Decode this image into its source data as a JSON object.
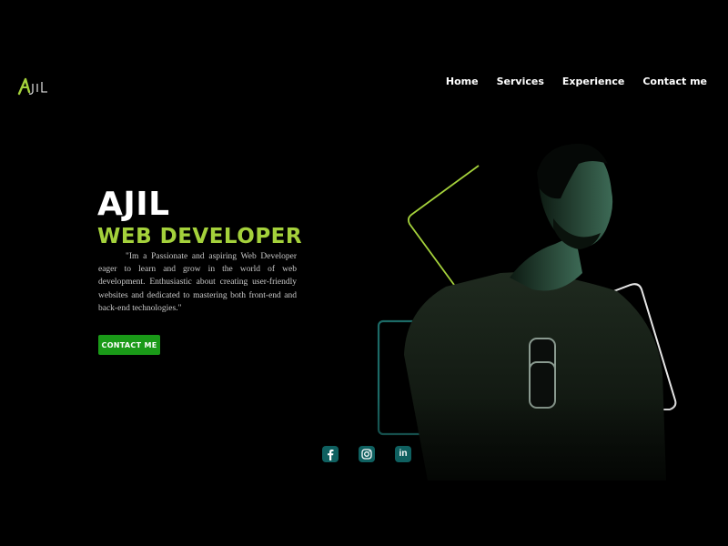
{
  "logo": {
    "text": "Ajil",
    "alt": "AJIL logo"
  },
  "nav": {
    "items": [
      {
        "label": "Home"
      },
      {
        "label": "Services"
      },
      {
        "label": "Experience"
      },
      {
        "label": "Contact me"
      }
    ]
  },
  "hero": {
    "name": "AJIL",
    "role": "WEB DEVELOPER",
    "bio": "\"Im a Passionate and aspiring Web Developer eager to learn and grow in the world of web development. Enthusiastic about creating user-friendly websites and dedicated to mastering both front-end and back-end technologies.\"",
    "cta_label": "CONTACT ME"
  },
  "social": [
    {
      "icon": "facebook-icon"
    },
    {
      "icon": "instagram-icon"
    },
    {
      "icon": "linkedin-icon",
      "text": "in"
    }
  ],
  "colors": {
    "background": "#000000",
    "accent": "#a4d13b",
    "button": "#1a9a18",
    "social_bg": "#0f6060",
    "frame_teal": "#1c6a66",
    "frame_white": "#e6e6e6"
  }
}
